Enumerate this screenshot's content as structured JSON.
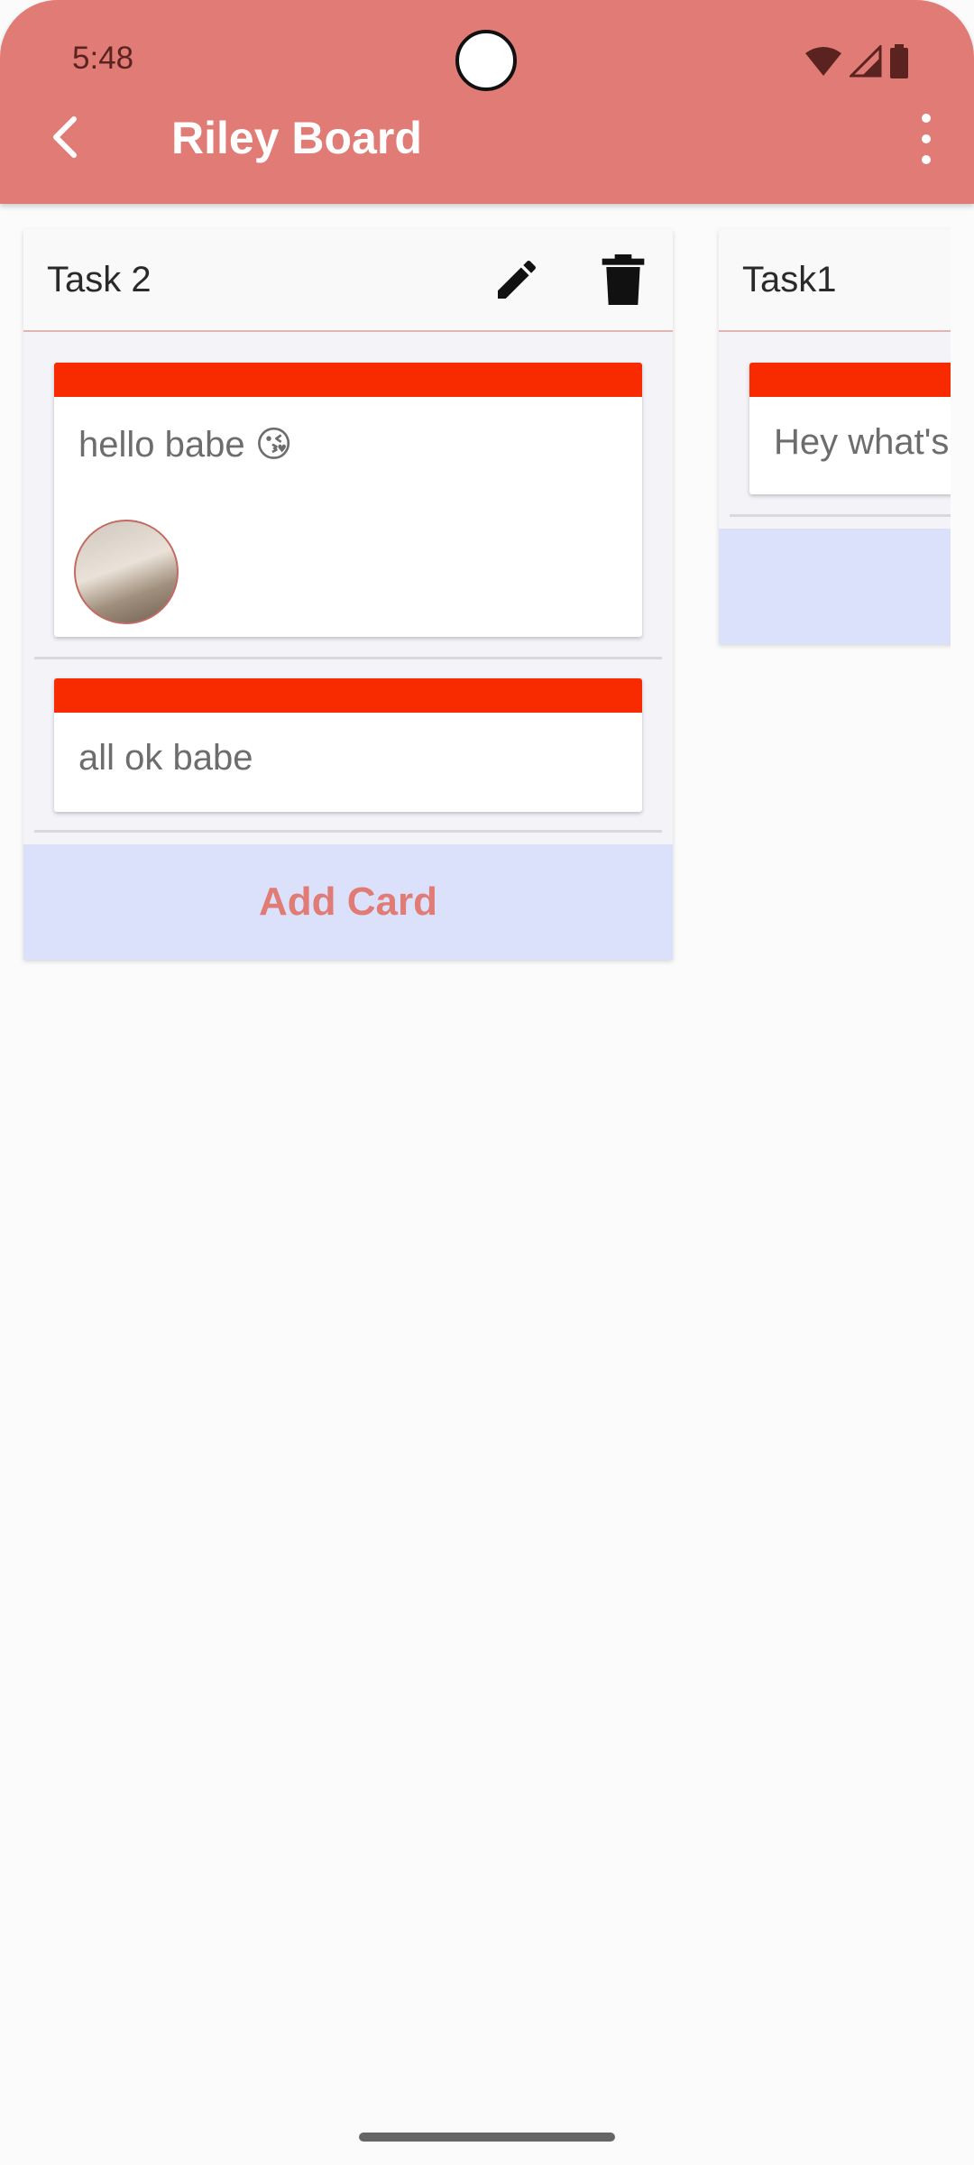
{
  "status_bar": {
    "time": "5:48"
  },
  "app_bar": {
    "title": "Riley Board"
  },
  "lists": [
    {
      "title": "Task 2",
      "cards": [
        {
          "text": "hello babe 😘",
          "has_image": true
        },
        {
          "text": "all ok babe",
          "has_image": false
        }
      ],
      "add_card_label": "Add Card"
    },
    {
      "title": "Task1",
      "cards": [
        {
          "text": "Hey what's",
          "has_image": false
        }
      ]
    }
  ],
  "colors": {
    "app_bar": "#e07b75",
    "card_label": "#f72a00",
    "add_card_bg": "#dce1fb",
    "add_card_text": "#e07b75"
  }
}
